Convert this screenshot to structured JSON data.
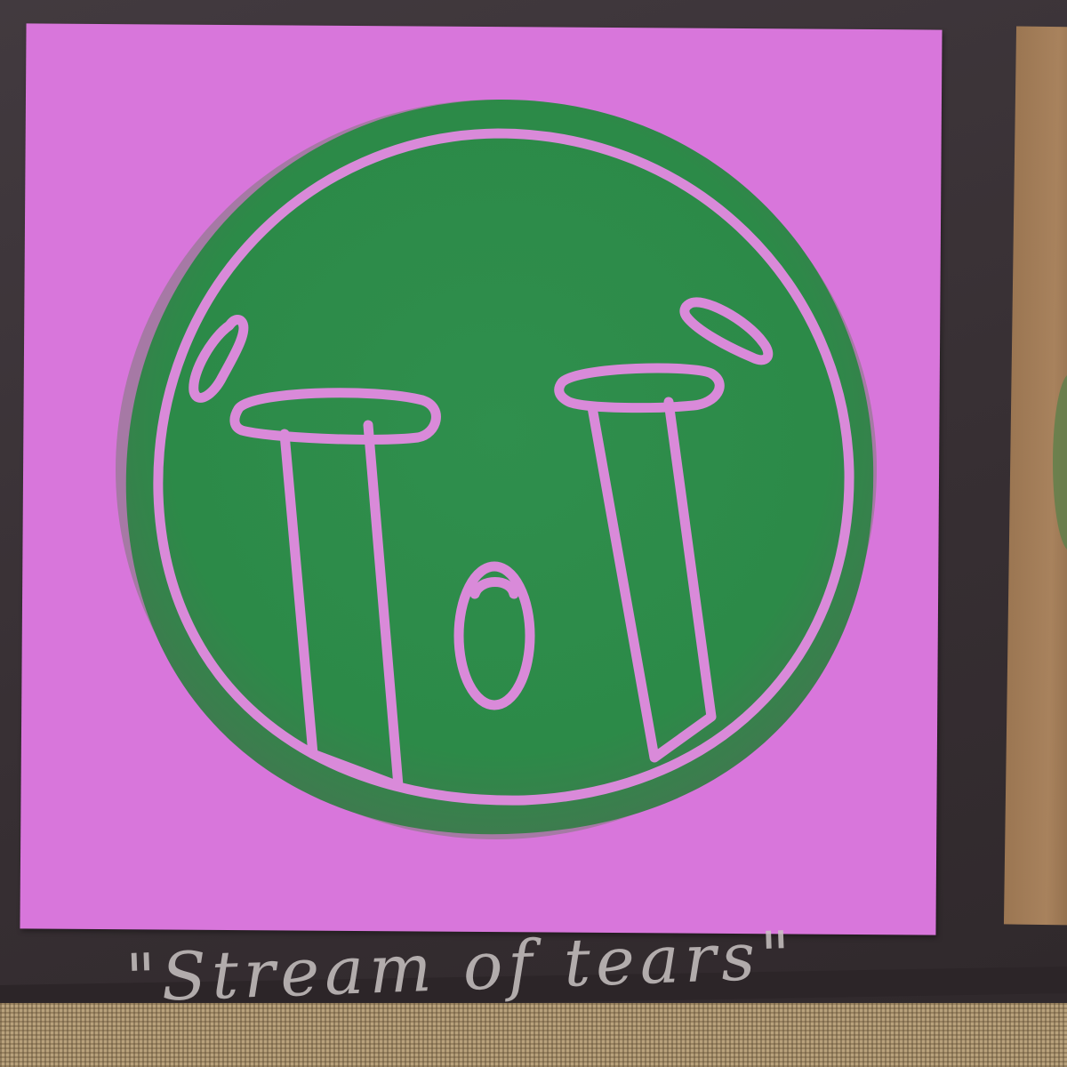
{
  "artwork": {
    "caption": "\"Stream of tears\"",
    "subject": "crying-face-print"
  },
  "colors": {
    "board": "#3a3034",
    "paper": "#d876db",
    "ink": "#2f8a4a",
    "ink_edge": "#6f7f66",
    "neighbor_paper": "#a8825d",
    "burlap": "#b9a27c",
    "caption_chalk": "#c9c3c2"
  }
}
